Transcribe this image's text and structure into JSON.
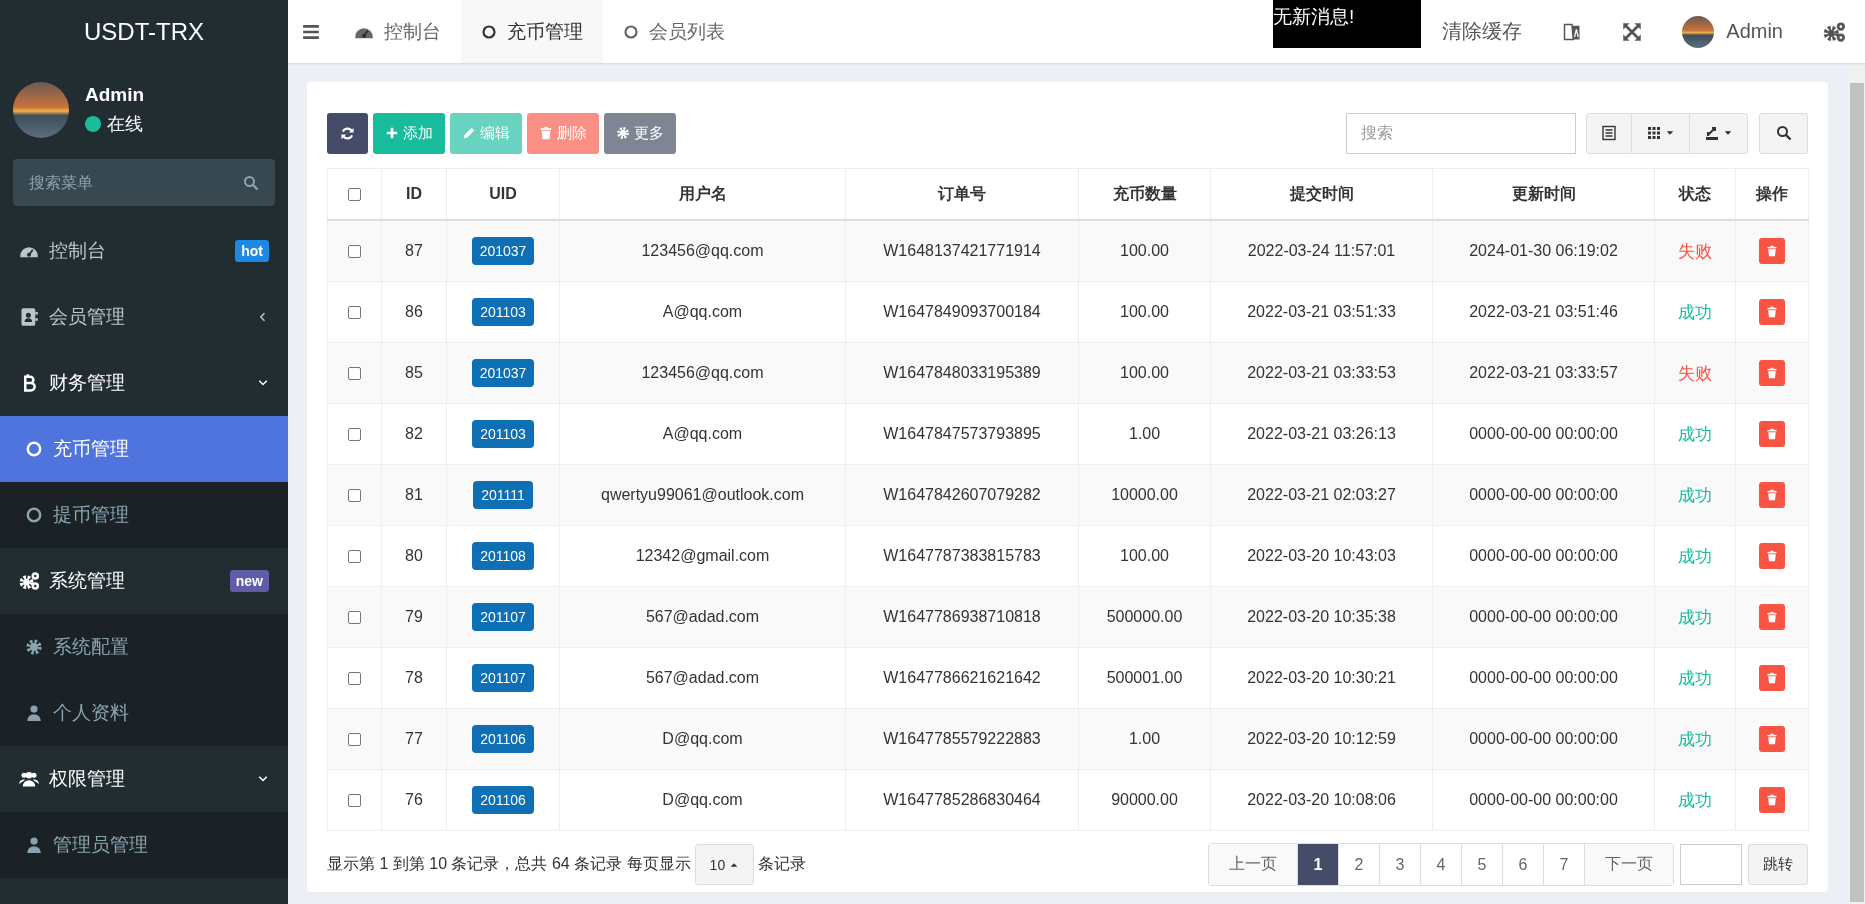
{
  "sidebar": {
    "logo": "USDT-TRX",
    "user": {
      "name": "Admin",
      "status": "在线",
      "online": true
    },
    "search": {
      "placeholder": "搜索菜单"
    },
    "menu": [
      {
        "label": "控制台",
        "badge": {
          "text": "hot",
          "color": "#1e88e5"
        }
      },
      {
        "label": "会员管理",
        "expanded": false
      },
      {
        "label": "财务管理",
        "expanded": true,
        "children": [
          {
            "label": "充币管理",
            "selected": true
          },
          {
            "label": "提币管理",
            "selected": false
          }
        ]
      },
      {
        "label": "系统管理",
        "badge": {
          "text": "new",
          "color": "#605ca8"
        },
        "expanded": true,
        "children": [
          {
            "label": "系统配置",
            "selected": false
          },
          {
            "label": "个人资料",
            "selected": false
          }
        ]
      },
      {
        "label": "权限管理",
        "expanded": true,
        "children": [
          {
            "label": "管理员管理",
            "selected": false
          }
        ]
      }
    ]
  },
  "topbar": {
    "tabs": [
      {
        "label": "控制台",
        "selected": false
      },
      {
        "label": "充币管理",
        "selected": true
      },
      {
        "label": "会员列表",
        "selected": false
      }
    ],
    "notice": "无新消息!",
    "clear_cache": "清除缓存",
    "user": "Admin"
  },
  "toolbar": {
    "buttons": [
      {
        "kind": "refresh",
        "disabled": false
      },
      {
        "label": "添加",
        "kind": "add",
        "disabled": false
      },
      {
        "label": "编辑",
        "kind": "edit",
        "disabled": true
      },
      {
        "label": "删除",
        "kind": "delete",
        "disabled": true
      },
      {
        "label": "更多",
        "kind": "more",
        "disabled": false
      }
    ],
    "search": {
      "placeholder": "搜索"
    }
  },
  "table": {
    "select_all_checked": false,
    "columns": [
      "",
      "ID",
      "UID",
      "用户名",
      "订单号",
      "充币数量",
      "提交时间",
      "更新时间",
      "状态",
      "操作"
    ],
    "rows": [
      {
        "checked": false,
        "id": "87",
        "uid": "201037",
        "user": "123456@qq.com",
        "order": "W1648137421771914",
        "amount": "100.00",
        "submitted": "2022-03-24 11:57:01",
        "updated": "2024-01-30 06:19:02",
        "status": "失败",
        "color": "#f75444"
      },
      {
        "checked": false,
        "id": "86",
        "uid": "201103",
        "user": "A@qq.com",
        "order": "W1647849093700184",
        "amount": "100.00",
        "submitted": "2022-03-21 03:51:33",
        "updated": "2022-03-21 03:51:46",
        "status": "成功",
        "color": "#18bc9c"
      },
      {
        "checked": false,
        "id": "85",
        "uid": "201037",
        "user": "123456@qq.com",
        "order": "W1647848033195389",
        "amount": "100.00",
        "submitted": "2022-03-21 03:33:53",
        "updated": "2022-03-21 03:33:57",
        "status": "失败",
        "color": "#f75444"
      },
      {
        "checked": false,
        "id": "82",
        "uid": "201103",
        "user": "A@qq.com",
        "order": "W1647847573793895",
        "amount": "1.00",
        "submitted": "2022-03-21 03:26:13",
        "updated": "0000-00-00 00:00:00",
        "status": "成功",
        "color": "#18bc9c"
      },
      {
        "checked": false,
        "id": "81",
        "uid": "201111",
        "user": "qwertyu99061@outlook.com",
        "order": "W1647842607079282",
        "amount": "10000.00",
        "submitted": "2022-03-21 02:03:27",
        "updated": "0000-00-00 00:00:00",
        "status": "成功",
        "color": "#18bc9c"
      },
      {
        "checked": false,
        "id": "80",
        "uid": "201108",
        "user": "12342@gmail.com",
        "order": "W1647787383815783",
        "amount": "100.00",
        "submitted": "2022-03-20 10:43:03",
        "updated": "0000-00-00 00:00:00",
        "status": "成功",
        "color": "#18bc9c"
      },
      {
        "checked": false,
        "id": "79",
        "uid": "201107",
        "user": "567@adad.com",
        "order": "W1647786938710818",
        "amount": "500000.00",
        "submitted": "2022-03-20 10:35:38",
        "updated": "0000-00-00 00:00:00",
        "status": "成功",
        "color": "#18bc9c"
      },
      {
        "checked": false,
        "id": "78",
        "uid": "201107",
        "user": "567@adad.com",
        "order": "W1647786621621642",
        "amount": "500001.00",
        "submitted": "2022-03-20 10:30:21",
        "updated": "0000-00-00 00:00:00",
        "status": "成功",
        "color": "#18bc9c"
      },
      {
        "checked": false,
        "id": "77",
        "uid": "201106",
        "user": "D@qq.com",
        "order": "W1647785579222883",
        "amount": "1.00",
        "submitted": "2022-03-20 10:12:59",
        "updated": "0000-00-00 00:00:00",
        "status": "成功",
        "color": "#18bc9c"
      },
      {
        "checked": false,
        "id": "76",
        "uid": "201106",
        "user": "D@qq.com",
        "order": "W1647785286830464",
        "amount": "90000.00",
        "submitted": "2022-03-20 10:08:06",
        "updated": "0000-00-00 00:00:00",
        "status": "成功",
        "color": "#18bc9c"
      }
    ]
  },
  "pagination": {
    "info": "显示第 1 到第 10 条记录，总共 64 条记录 每页显示",
    "page_size": "10",
    "info_suffix": "条记录",
    "prev": "上一页",
    "pages": [
      {
        "label": "1",
        "selected": true
      },
      {
        "label": "2",
        "selected": false
      },
      {
        "label": "3",
        "selected": false
      },
      {
        "label": "4",
        "selected": false
      },
      {
        "label": "5",
        "selected": false
      },
      {
        "label": "6",
        "selected": false
      },
      {
        "label": "7",
        "selected": false
      }
    ],
    "next": "下一页",
    "jump": "跳转"
  }
}
